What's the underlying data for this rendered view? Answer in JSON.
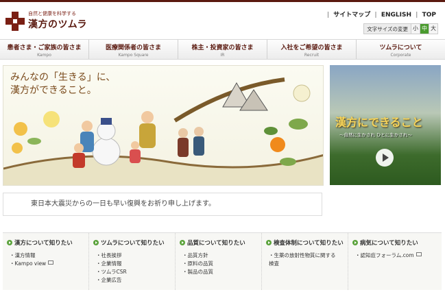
{
  "brand": {
    "tagline": "自然と健康を科学する",
    "name": "漢方のツムラ"
  },
  "utility": {
    "links": [
      "サイトマップ",
      "ENGLISH",
      "TOP"
    ]
  },
  "font_size": {
    "label": "文字サイズの変更",
    "options": [
      "小",
      "中",
      "大"
    ],
    "selected": "中"
  },
  "nav": [
    {
      "title": "患者さま・ご家族の皆さま",
      "sub": "Kampo"
    },
    {
      "title": "医療関係者の皆さま",
      "sub": "Kampo Square"
    },
    {
      "title": "株主・投資家の皆さま",
      "sub": "IR"
    },
    {
      "title": "入社をご希望の皆さま",
      "sub": "Recruit"
    },
    {
      "title": "ツムラについて",
      "sub": "Corporate"
    }
  ],
  "hero": {
    "line1": "みんなの「生きる」に、",
    "line2": "漢方ができること。"
  },
  "video": {
    "title": "漢方にできること",
    "subtitle": "〜自然に生かされ ひとに生かされ〜"
  },
  "notice": "東日本大震災からの一日も早い復興をお祈り申し上げます。",
  "columns": [
    {
      "heading": "漢方について知りたい",
      "items": [
        "漢方情報",
        "Kampo view"
      ]
    },
    {
      "heading": "ツムラについて知りたい",
      "items": [
        "社長挨拶",
        "企業情報",
        "ツムラCSR",
        "企業広告"
      ]
    },
    {
      "heading": "品質について知りたい",
      "items": [
        "品質方針",
        "原料の品質",
        "製品の品質"
      ]
    },
    {
      "heading": "検査体制について知りたい",
      "items": [
        "生薬の放射性物質に関する検査"
      ]
    },
    {
      "heading": "病気について知りたい",
      "items": [
        "認知症フォーラム.com"
      ]
    }
  ],
  "colors": {
    "brand": "#7a1f14",
    "accent_green": "#4a9b2f"
  }
}
